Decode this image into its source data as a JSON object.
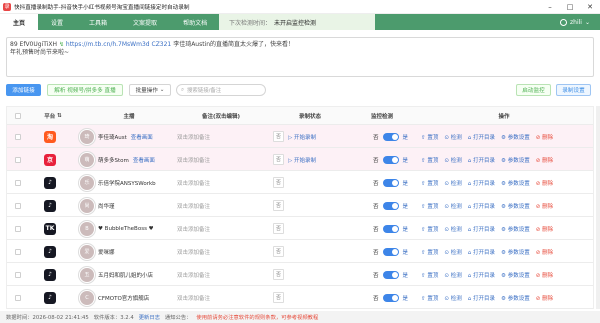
{
  "window": {
    "title": "快抖直播录制助手-抖音快手小红书视频号淘宝直播间链接定时自动录制",
    "app_icon_text": "录"
  },
  "menubar": {
    "items": [
      "主页",
      "设置",
      "工具箱",
      "文案提取",
      "帮助文档"
    ],
    "notice_label": "下次检测时间：",
    "notice_value": "未开启监控检测",
    "user": "zhili"
  },
  "input": {
    "text_prefix": "89 ",
    "code": "EfV0UgiTiXH",
    "url": "https://m.tb.cn/h.7MsWm3d",
    "code2": "CZ321",
    "text_suffix": "李佳琦Austin的直播简直太火爆了，快来看！",
    "line2": "年礼预售时尚节来啦~"
  },
  "toolbar": {
    "add_link": "添加链接",
    "parse": "解析 视频号/拼多多 直播",
    "batch": "批量操作",
    "search_placeholder": "搜索链接/备注",
    "start_monitor": "启动监控",
    "record_settings": "录制设置"
  },
  "table": {
    "headers": [
      "平台",
      "主播",
      "备注(双击编辑)",
      "录制状态",
      "监控检测",
      "操作"
    ],
    "view_label": "查看画面",
    "note_placeholder": "双击添加备注",
    "status_no": "否",
    "start_record": "开始录制",
    "monitor_no": "否",
    "monitor_yes": "是",
    "ops": [
      "置顶",
      "检测",
      "打开目录",
      "参数设置",
      "删除"
    ],
    "rows": [
      {
        "platform": "淘",
        "platform_color": "#ff5a1f",
        "avatar_text": "琦",
        "anchor": "李佳琦Aust",
        "has_view": true,
        "pink": true
      },
      {
        "platform": "京",
        "platform_color": "#e8203b",
        "avatar_text": "萌",
        "anchor": "萌多多Stom",
        "has_view": true,
        "pink": true
      },
      {
        "platform": "♪",
        "platform_color": "#161823",
        "avatar_text": "乐",
        "anchor": "乐倍学院ANSYSWorkb",
        "has_view": false,
        "pink": false
      },
      {
        "platform": "♪",
        "platform_color": "#161823",
        "avatar_text": "尚",
        "anchor": "尚华瑾",
        "has_view": false,
        "pink": false
      },
      {
        "platform": "TK",
        "platform_color": "#161823",
        "avatar_text": "B",
        "anchor": "♥ BubbleTheBoss ♥",
        "has_view": false,
        "pink": false
      },
      {
        "platform": "♪",
        "platform_color": "#161823",
        "avatar_text": "爱",
        "anchor": "爱咪娜",
        "has_view": false,
        "pink": false
      },
      {
        "platform": "♪",
        "platform_color": "#161823",
        "avatar_text": "五",
        "anchor": "五月妈和肌儿姐的小店",
        "has_view": false,
        "pink": false
      },
      {
        "platform": "♪",
        "platform_color": "#161823",
        "avatar_text": "C",
        "anchor": "CFMOTO官方旗舰店",
        "has_view": false,
        "pink": false
      }
    ]
  },
  "statusbar": {
    "time": "数据时间：2026-08-02 21:41:45",
    "version": "软件版本：3.2.4",
    "update": "更新日志",
    "announce_label": "通知公告：",
    "announce": "使用前请务必注意软件的规则条款，可参考视频教程"
  }
}
